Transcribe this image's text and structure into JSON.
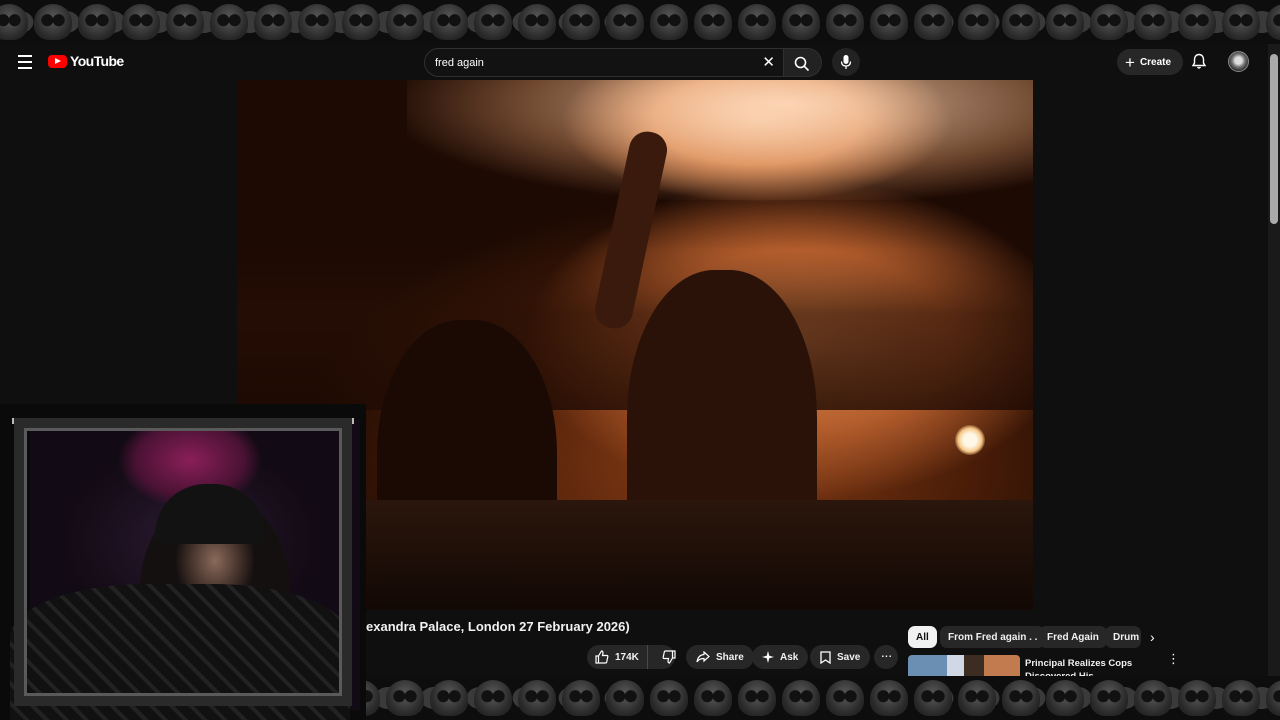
{
  "masthead": {
    "logo_text": "YouTube",
    "search": {
      "value": "fred again",
      "placeholder": "Search"
    },
    "create_label": "Create"
  },
  "video": {
    "title": "exandra Palace, London 27 February 2026)",
    "likes": "174K",
    "share_label": "Share",
    "ask_label": "Ask",
    "save_label": "Save"
  },
  "chips": [
    "All",
    "From Fred again . .",
    "Fred Again",
    "Drum"
  ],
  "recommended": [
    {
      "title": "Principal Realizes Cops Discovered His Disgusting"
    }
  ],
  "colors": {
    "brand_red": "#ff0000",
    "background": "#0f0f0f",
    "pill": "#272727"
  }
}
